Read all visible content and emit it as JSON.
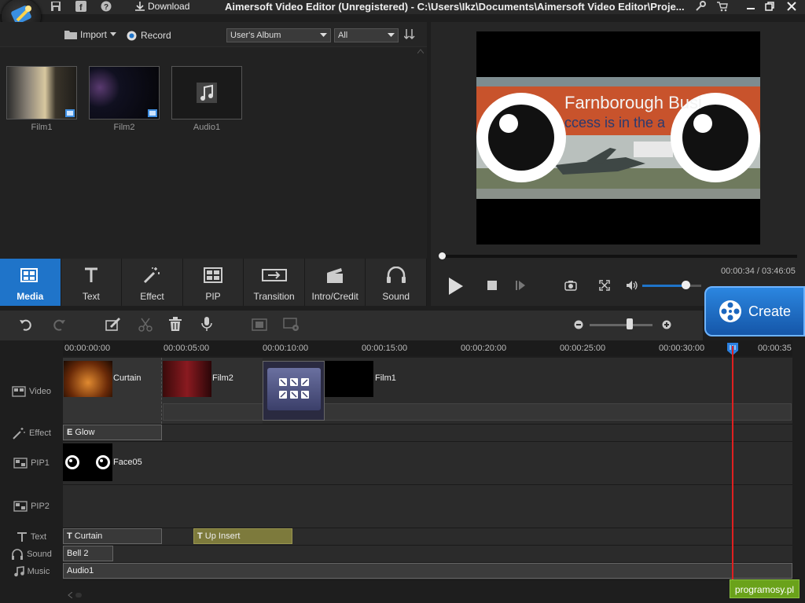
{
  "titlebar": {
    "title": "Aimersoft Video Editor (Unregistered) - C:\\Users\\Ikz\\Documents\\Aimersoft Video Editor\\Proje...",
    "download_label": "Download"
  },
  "media_toolbar": {
    "import_label": "Import",
    "record_label": "Record",
    "album_selected": "User's Album",
    "filter_selected": "All"
  },
  "media_items": [
    {
      "label": "Film1"
    },
    {
      "label": "Film2"
    },
    {
      "label": "Audio1"
    }
  ],
  "tabs": [
    {
      "label": "Media",
      "icon": "media-icon"
    },
    {
      "label": "Text",
      "icon": "text-icon"
    },
    {
      "label": "Effect",
      "icon": "effect-icon"
    },
    {
      "label": "PIP",
      "icon": "pip-icon"
    },
    {
      "label": "Transition",
      "icon": "transition-icon"
    },
    {
      "label": "Intro/Credit",
      "icon": "intro-credit-icon"
    },
    {
      "label": "Sound",
      "icon": "sound-icon"
    }
  ],
  "preview": {
    "timecode": "00:00:34 / 03:46:05",
    "sign_line1": "Farnborough Busi",
    "sign_line2": "ccess is in the a",
    "volume_fraction": 0.73,
    "seek_fraction": 0.0
  },
  "create_label": "Create",
  "ruler": [
    "00:00:00:00",
    "00:00:05:00",
    "00:00:10:00",
    "00:00:15:00",
    "00:00:20:00",
    "00:00:25:00",
    "00:00:30:00",
    "00:00:35"
  ],
  "tracks": {
    "video": "Video",
    "effect": "Effect",
    "pip1": "PIP1",
    "pip2": "PIP2",
    "text": "Text",
    "sound": "Sound",
    "music": "Music"
  },
  "clips": {
    "video_curtain": "Curtain",
    "video_film2": "Film2",
    "video_film1": "Film1",
    "effect_glow": "Glow",
    "pip_face": "Face05",
    "text_curtain": "Curtain",
    "text_upinsert": "Up Insert",
    "sound_bell": "Bell 2",
    "music_audio": "Audio1"
  },
  "watermark": "programosy.pl",
  "colors": {
    "accent": "#1f74c9",
    "playhead": "#e02020",
    "text_clip_highlight": "#7d7a3c"
  }
}
